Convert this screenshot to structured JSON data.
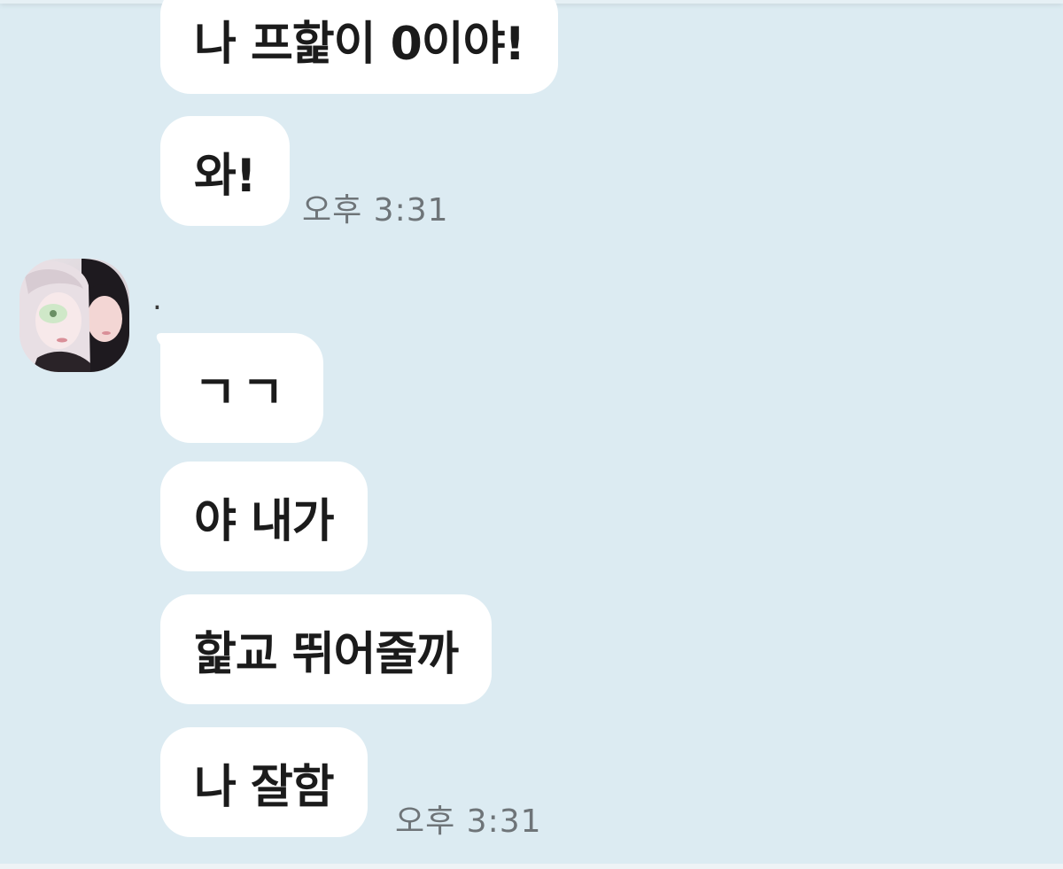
{
  "colors": {
    "chat_background": "#dcebf2",
    "bubble_background": "#ffffff",
    "message_text": "#1b1b1b",
    "timestamp_text": "#6e7478"
  },
  "messages_group_1": [
    {
      "text": "나 프핥이 0이야!"
    },
    {
      "text": "와!"
    }
  ],
  "group_1_time": "오후 3:31",
  "sender": {
    "name": ".",
    "avatar_icon": "profile-photo-two-people"
  },
  "messages_group_2": [
    {
      "text": "ㄱㄱ"
    },
    {
      "text": "야 내가"
    },
    {
      "text": "핥교 뛰어줄까"
    },
    {
      "text": "나 잘함"
    }
  ],
  "group_2_time": "오후 3:31"
}
